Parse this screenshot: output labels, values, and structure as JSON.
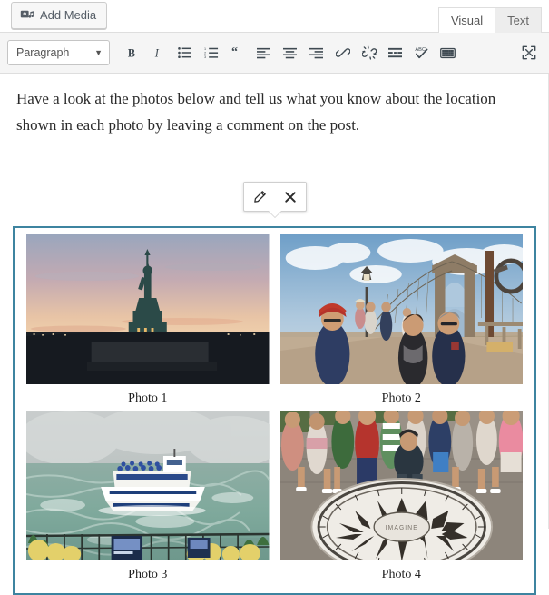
{
  "topbar": {
    "add_media_label": "Add Media",
    "add_media_icon": "media-library-icon",
    "tabs": [
      {
        "label": "Visual",
        "active": true
      },
      {
        "label": "Text",
        "active": false
      }
    ]
  },
  "toolbar": {
    "format_value": "Paragraph",
    "format_caret_icon": "chevron-down-icon",
    "buttons": [
      {
        "name": "bold-button",
        "icon": "bold-icon",
        "label": "B"
      },
      {
        "name": "italic-button",
        "icon": "italic-icon",
        "label": "I"
      },
      {
        "name": "bullet-list-button",
        "icon": "unordered-list-icon",
        "label": ""
      },
      {
        "name": "numbered-list-button",
        "icon": "ordered-list-icon",
        "label": ""
      },
      {
        "name": "blockquote-button",
        "icon": "blockquote-icon",
        "label": ""
      },
      {
        "name": "align-left-button",
        "icon": "align-left-icon",
        "label": ""
      },
      {
        "name": "align-center-button",
        "icon": "align-center-icon",
        "label": ""
      },
      {
        "name": "align-right-button",
        "icon": "align-right-icon",
        "label": ""
      },
      {
        "name": "insert-link-button",
        "icon": "link-icon",
        "label": ""
      },
      {
        "name": "remove-link-button",
        "icon": "unlink-icon",
        "label": ""
      },
      {
        "name": "read-more-button",
        "icon": "insert-more-icon",
        "label": ""
      },
      {
        "name": "spellcheck-button",
        "icon": "abc-spellcheck-icon",
        "label": "ABC"
      },
      {
        "name": "toolbar-toggle-button",
        "icon": "keyboard-icon",
        "label": ""
      },
      {
        "name": "fullscreen-button",
        "icon": "fullscreen-expand-icon",
        "label": ""
      }
    ]
  },
  "content": {
    "paragraph": "Have a look at the photos below and tell us what you know about the location shown in each photo by leaving a comment on the post.",
    "image_toolbar": {
      "edit_icon": "pencil-edit-icon",
      "remove_icon": "close-remove-icon"
    }
  },
  "gallery": {
    "selected": true,
    "selection_color": "#3e84a0",
    "photos": [
      {
        "caption": "Photo 1",
        "subject": "statue-of-liberty-at-sunset"
      },
      {
        "caption": "Photo 2",
        "subject": "brooklyn-bridge-walkway-with-people"
      },
      {
        "caption": "Photo 3",
        "subject": "niagara-falls-maid-of-the-mist-boat"
      },
      {
        "caption": "Photo 4",
        "subject": "imagine-mosaic-strawberry-fields"
      }
    ]
  }
}
